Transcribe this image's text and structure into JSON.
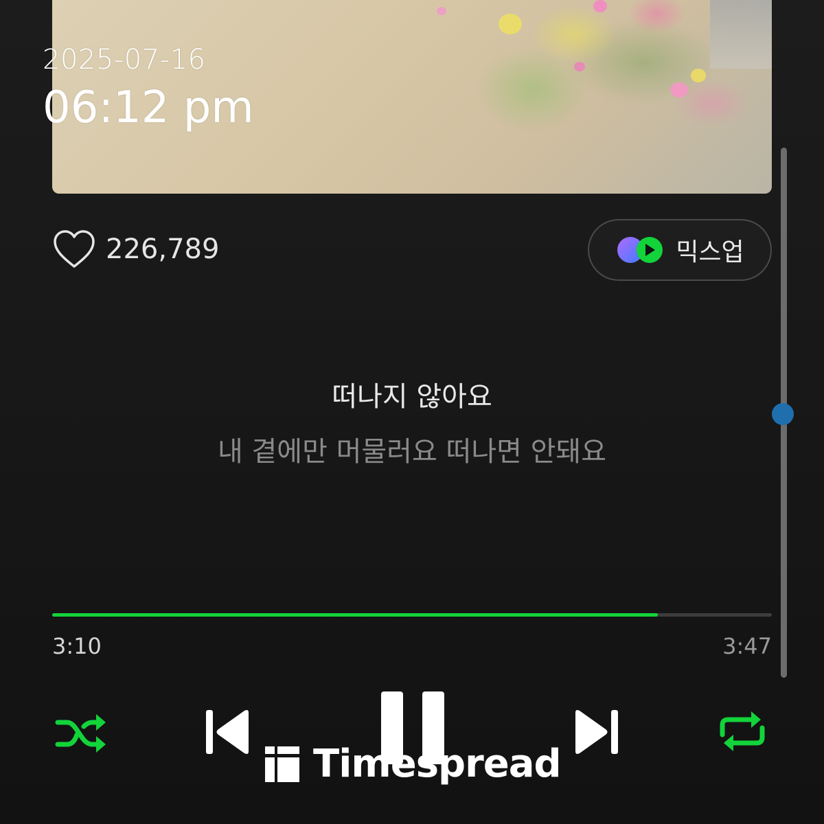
{
  "timestamp": {
    "date": "2025-07-16",
    "time": "06:12 pm"
  },
  "track": {
    "like_count": "226,789",
    "progress_fraction": 0.842,
    "elapsed": "3:10",
    "total": "3:47"
  },
  "mixup": {
    "label": "믹스업"
  },
  "lyrics": {
    "current": "떠나지 않아요",
    "next": "내 곁에만 머물러요 떠나면 안돼요"
  },
  "controls": {
    "shuffle_icon": "shuffle-icon",
    "prev_icon": "skip-previous-icon",
    "pause_icon": "pause-icon",
    "next_icon": "skip-next-icon",
    "repeat_icon": "repeat-icon"
  },
  "watermark": {
    "text": "Timespread"
  },
  "colors": {
    "accent_green": "#13d33a",
    "background": "#181818",
    "scroll_thumb": "#1f6fae"
  }
}
